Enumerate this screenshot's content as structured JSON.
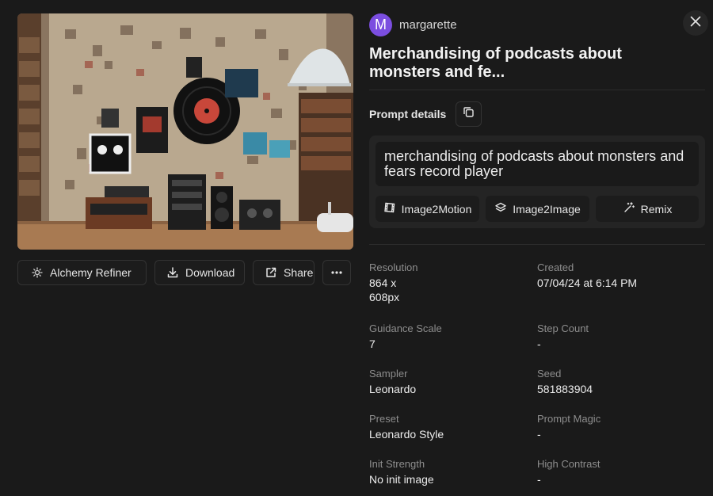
{
  "image": {
    "alt": ""
  },
  "actions": {
    "alchemy_label": "Alchemy Refiner",
    "download_label": "Download",
    "share_label": "Share"
  },
  "user": {
    "initial": "M",
    "name": "margarette"
  },
  "title": "Merchandising of podcasts about monsters and fe...",
  "prompt": {
    "label": "Prompt details",
    "text": "merchandising of podcasts about monsters and fears record player",
    "buttons": {
      "motion": "Image2Motion",
      "i2i": "Image2Image",
      "remix": "Remix"
    }
  },
  "details": {
    "resolution": {
      "k": "Resolution",
      "v": "864 x 608px"
    },
    "created": {
      "k": "Created",
      "v": "07/04/24 at 6:14 PM"
    },
    "guidance": {
      "k": "Guidance Scale",
      "v": "7"
    },
    "step": {
      "k": "Step Count",
      "v": "-"
    },
    "sampler": {
      "k": "Sampler",
      "v": "Leonardo"
    },
    "seed": {
      "k": "Seed",
      "v": "581883904"
    },
    "preset": {
      "k": "Preset",
      "v": "Leonardo Style"
    },
    "magic": {
      "k": "Prompt Magic",
      "v": "-"
    },
    "init": {
      "k": "Init Strength",
      "v": "No init image"
    },
    "contrast": {
      "k": "High Contrast",
      "v": "-"
    }
  },
  "colors": {
    "background": "#1a1a1a",
    "avatar": "#7b4ee0",
    "panel": "#242424"
  }
}
